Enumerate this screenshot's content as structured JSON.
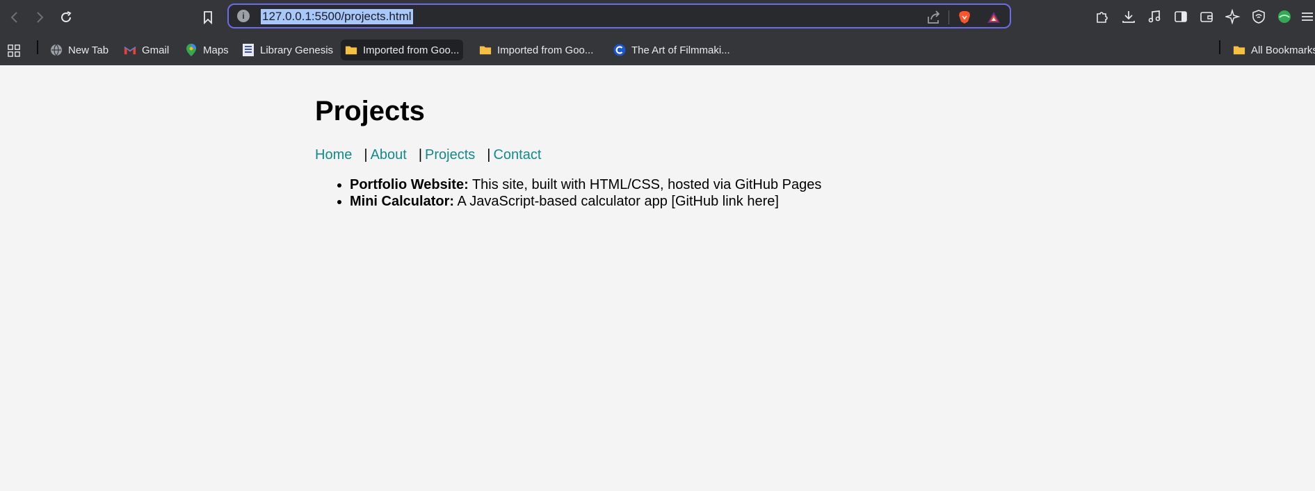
{
  "browser": {
    "url": "127.0.0.1:5500/projects.html",
    "bookmarks": [
      {
        "label": "New Tab",
        "icon": "globe-icon"
      },
      {
        "label": "Gmail",
        "icon": "gmail-icon"
      },
      {
        "label": "Maps",
        "icon": "maps-icon"
      },
      {
        "label": "Library Genesis",
        "icon": "library-icon"
      },
      {
        "label": "Imported from Goo...",
        "icon": "folder-icon"
      },
      {
        "label": "Imported from Goo...",
        "icon": "folder-icon"
      },
      {
        "label": "The Art of Filmmaki...",
        "icon": "c-logo-icon"
      },
      {
        "label": "All Bookmarks",
        "icon": "folder-icon"
      }
    ],
    "colors": {
      "chrome": "#35363a",
      "url_focus": "#6e6be8",
      "selection": "#a8c7fa"
    }
  },
  "page": {
    "title": "Projects",
    "nav": {
      "home": "Home",
      "about": "About",
      "projects": "Projects",
      "contact": "Contact",
      "separator": "|"
    },
    "projects": [
      {
        "name": "Portfolio Website:",
        "desc": " This site, built with HTML/CSS, hosted via GitHub Pages"
      },
      {
        "name": "Mini Calculator:",
        "desc": " A JavaScript-based calculator app [GitHub link here]"
      }
    ],
    "colors": {
      "link": "#138a8a",
      "background": "#f4f4f4"
    }
  }
}
